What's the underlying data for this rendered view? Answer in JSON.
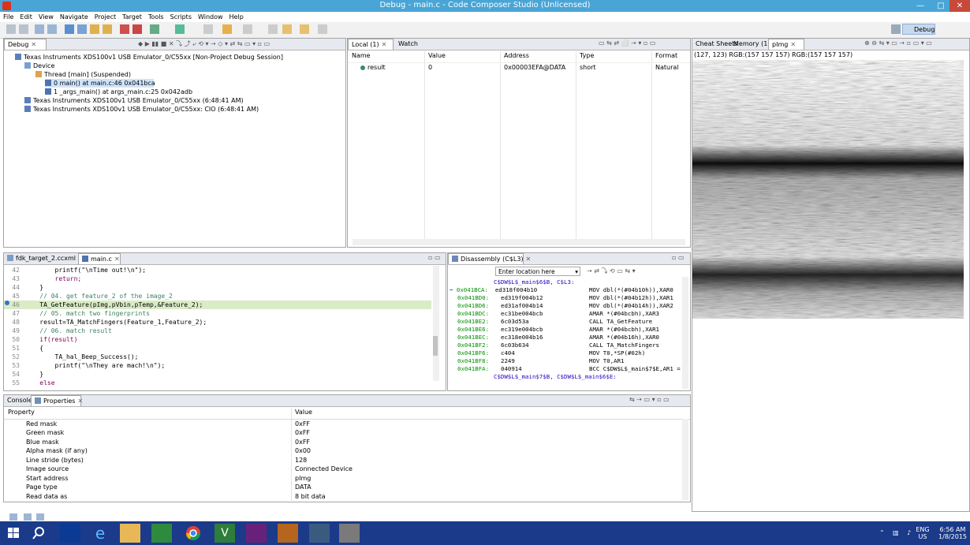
{
  "window": {
    "title": "Debug - main.c - Code Composer Studio (Unlicensed)",
    "minimize_label": "—",
    "maximize_label": "□",
    "close_label": "✕"
  },
  "menu": [
    "File",
    "Edit",
    "View",
    "Navigate",
    "Project",
    "Target",
    "Tools",
    "Scripts",
    "Window",
    "Help"
  ],
  "perspective": {
    "label": "Debug"
  },
  "debug_panel": {
    "tab": "Debug",
    "tree": [
      "Texas Instruments XDS100v1 USB Emulator_0/C55xx [Non-Project Debug Session]",
      "Device",
      "Thread [main] (Suspended)",
      "0 main() at main.c:46 0x041bca",
      "1 _args_main() at args_main.c:25 0x042adb",
      "Texas Instruments XDS100v1 USB Emulator_0/C55xx (6:48:41 AM)",
      "Texas Instruments XDS100v1 USB Emulator_0/C55xx: CIO (6:48:41 AM)"
    ]
  },
  "variables_panel": {
    "tabs": [
      "Local (1)",
      "Watch"
    ],
    "columns": [
      "Name",
      "Value",
      "Address",
      "Type",
      "Format"
    ],
    "rows": [
      {
        "name": "result",
        "value": "0",
        "address": "0x00003EFA@DATA",
        "type": "short",
        "format": "Natural"
      }
    ]
  },
  "image_panel": {
    "tabs": [
      "Cheat Sheets",
      "Memory (1)",
      "pImg"
    ],
    "status": "(127, 123) RGB:(157 157 157) RGB:(157 157 157)"
  },
  "editor": {
    "tabs": [
      "fdk_target_2.ccxml",
      "main.c"
    ],
    "lines": [
      {
        "n": "42",
        "code": "        printf(\"\\nTime out!\\n\");"
      },
      {
        "n": "43",
        "code": "        return;"
      },
      {
        "n": "44",
        "code": "    }"
      },
      {
        "n": "45",
        "code": "    // 04. get feature_2 of the image_2"
      },
      {
        "n": "46",
        "code": "    TA_GetFeature(pImg,pVbin,pTemp,&Feature_2);"
      },
      {
        "n": "47",
        "code": "    // 05. match two fingerprints"
      },
      {
        "n": "48",
        "code": "    result=TA_MatchFingers(Feature_1,Feature_2);"
      },
      {
        "n": "49",
        "code": "    // 06. match result"
      },
      {
        "n": "50",
        "code": "    if(result)"
      },
      {
        "n": "51",
        "code": "    {"
      },
      {
        "n": "52",
        "code": "        TA_hal_Beep_Success();"
      },
      {
        "n": "53",
        "code": "        printf(\"\\nThey are mach!\\n\");"
      },
      {
        "n": "54",
        "code": "    }"
      },
      {
        "n": "55",
        "code": "    else"
      }
    ]
  },
  "disassembly": {
    "tab": "Disassembly (C$L3)",
    "location_placeholder": "Enter location here",
    "header_label": "C$DW$L$_main$6$B, C$L3:",
    "footer_label": "C$DW$L$_main$7$B, C$DW$L$_main$6$E:",
    "rows": [
      {
        "addr": "0x041BCA:",
        "op": "ed318f004b10",
        "ins": "MOV dbl(*(#04b10h)),XAR0"
      },
      {
        "addr": "0x041BD0:",
        "op": "ed319f004b12",
        "ins": "MOV dbl(*(#04b12h)),XAR1"
      },
      {
        "addr": "0x041BD6:",
        "op": "ed31af004b14",
        "ins": "MOV dbl(*(#04b14h)),XAR2"
      },
      {
        "addr": "0x041BDC:",
        "op": "ec31be004bcb",
        "ins": "AMAR *(#04bcbh),XAR3"
      },
      {
        "addr": "0x041BE2:",
        "op": "6c03d53a",
        "ins": "CALL TA_GetFeature"
      },
      {
        "addr": "0x041BE6:",
        "op": "ec319e004bcb",
        "ins": "AMAR *(#04bcbh),XAR1"
      },
      {
        "addr": "0x041BEC:",
        "op": "ec318e004b16",
        "ins": "AMAR *(#04b16h),XAR0"
      },
      {
        "addr": "0x041BF2:",
        "op": "6c03b634",
        "ins": "CALL TA_MatchFingers"
      },
      {
        "addr": "0x041BF6:",
        "op": "c404",
        "ins": "MOV T0,*SP(#02h)"
      },
      {
        "addr": "0x041BF8:",
        "op": "2249",
        "ins": "MOV T0,AR1"
      },
      {
        "addr": "0x041BFA:",
        "op": "040914",
        "ins": "BCC C$DW$L$_main$7$E,AR1 ="
      }
    ]
  },
  "bottom_panel": {
    "tabs": [
      "Console",
      "Properties"
    ],
    "columns": [
      "Property",
      "Value"
    ],
    "rows": [
      {
        "p": "Red mask",
        "v": "0xFF"
      },
      {
        "p": "Green mask",
        "v": "0xFF"
      },
      {
        "p": "Blue mask",
        "v": "0xFF"
      },
      {
        "p": "Alpha mask (if any)",
        "v": "0x00"
      },
      {
        "p": "Line stride (bytes)",
        "v": "128"
      },
      {
        "p": "Image source",
        "v": "Connected Device"
      },
      {
        "p": "Start address",
        "v": "pImg"
      },
      {
        "p": "Page type",
        "v": "DATA"
      },
      {
        "p": "Read data as",
        "v": "8 bit data"
      }
    ]
  },
  "taskbar": {
    "lang1": "ENG",
    "lang2": "US",
    "time": "6:56 AM",
    "date": "1/8/2015"
  }
}
